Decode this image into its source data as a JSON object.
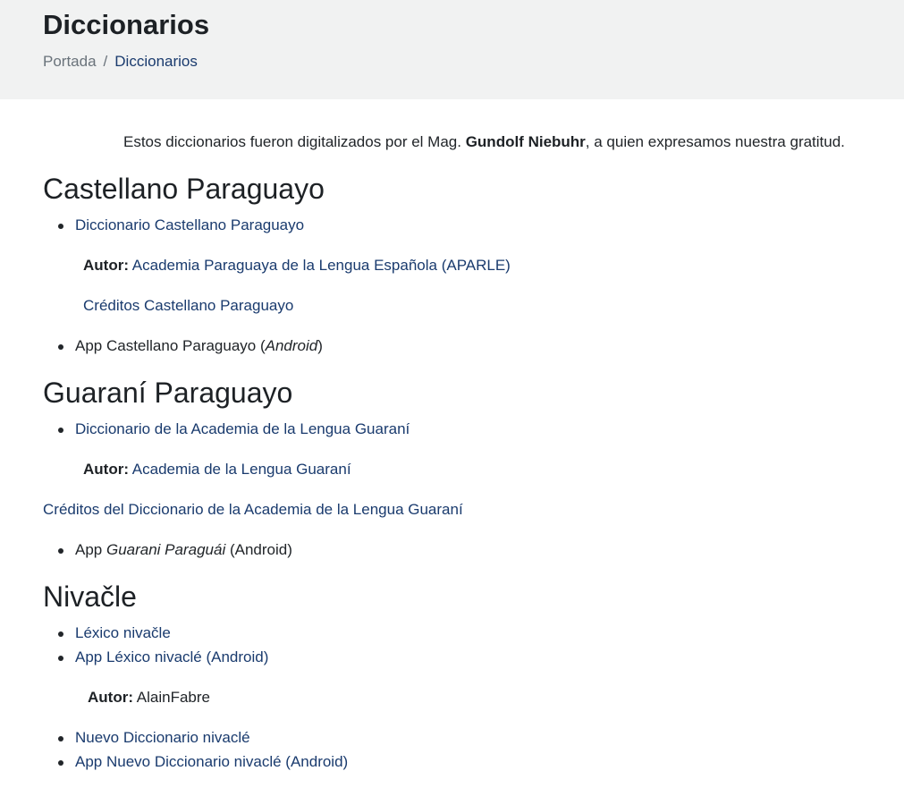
{
  "header": {
    "title": "Diccionarios",
    "breadcrumb": {
      "home": "Portada",
      "separator": "/",
      "current": "Diccionarios"
    }
  },
  "intro": {
    "prefix": "Estos diccionarios fueron digitalizados por el Mag. ",
    "name": "Gundolf Niebuhr",
    "suffix": ", a quien expresamos nuestra gratitud."
  },
  "sections": {
    "castellano": {
      "heading": "Castellano Paraguayo",
      "dict_link": "Diccionario Castellano Paraguayo",
      "author_label": "Autor:",
      "author_value": " Academia Paraguaya de la Lengua Española (APARLE)",
      "credits_link": "Créditos Castellano Paraguayo",
      "app_prefix": "App Castellano Paraguayo (",
      "app_platform": "Android",
      "app_suffix": ")"
    },
    "guarani": {
      "heading": "Guaraní Paraguayo",
      "dict_link": "Diccionario de la Academia de la Lengua Guaraní",
      "author_label": "Autor:",
      "author_value": " Academia de la Lengua Guaraní",
      "credits_link": "Créditos del Diccionario de la Academia de la Lengua Guaraní",
      "app_prefix": "App ",
      "app_name": "Guarani Paraguái",
      "app_suffix": " (Android)"
    },
    "nivacle": {
      "heading": "Nivačle",
      "lexico_link": "Léxico nivačle",
      "app_lexico": "App Léxico nivaclé (Android)",
      "author_label": "Autor:",
      "author_value": " AlainFabre",
      "nuevo_link": "Nuevo Diccionario nivaclé",
      "app_nuevo": "App Nuevo Diccionario nivaclé (Android)"
    }
  },
  "colors": {
    "header_bg": "#f1f2f2",
    "link": "#1a3b6e",
    "text": "#212529"
  }
}
